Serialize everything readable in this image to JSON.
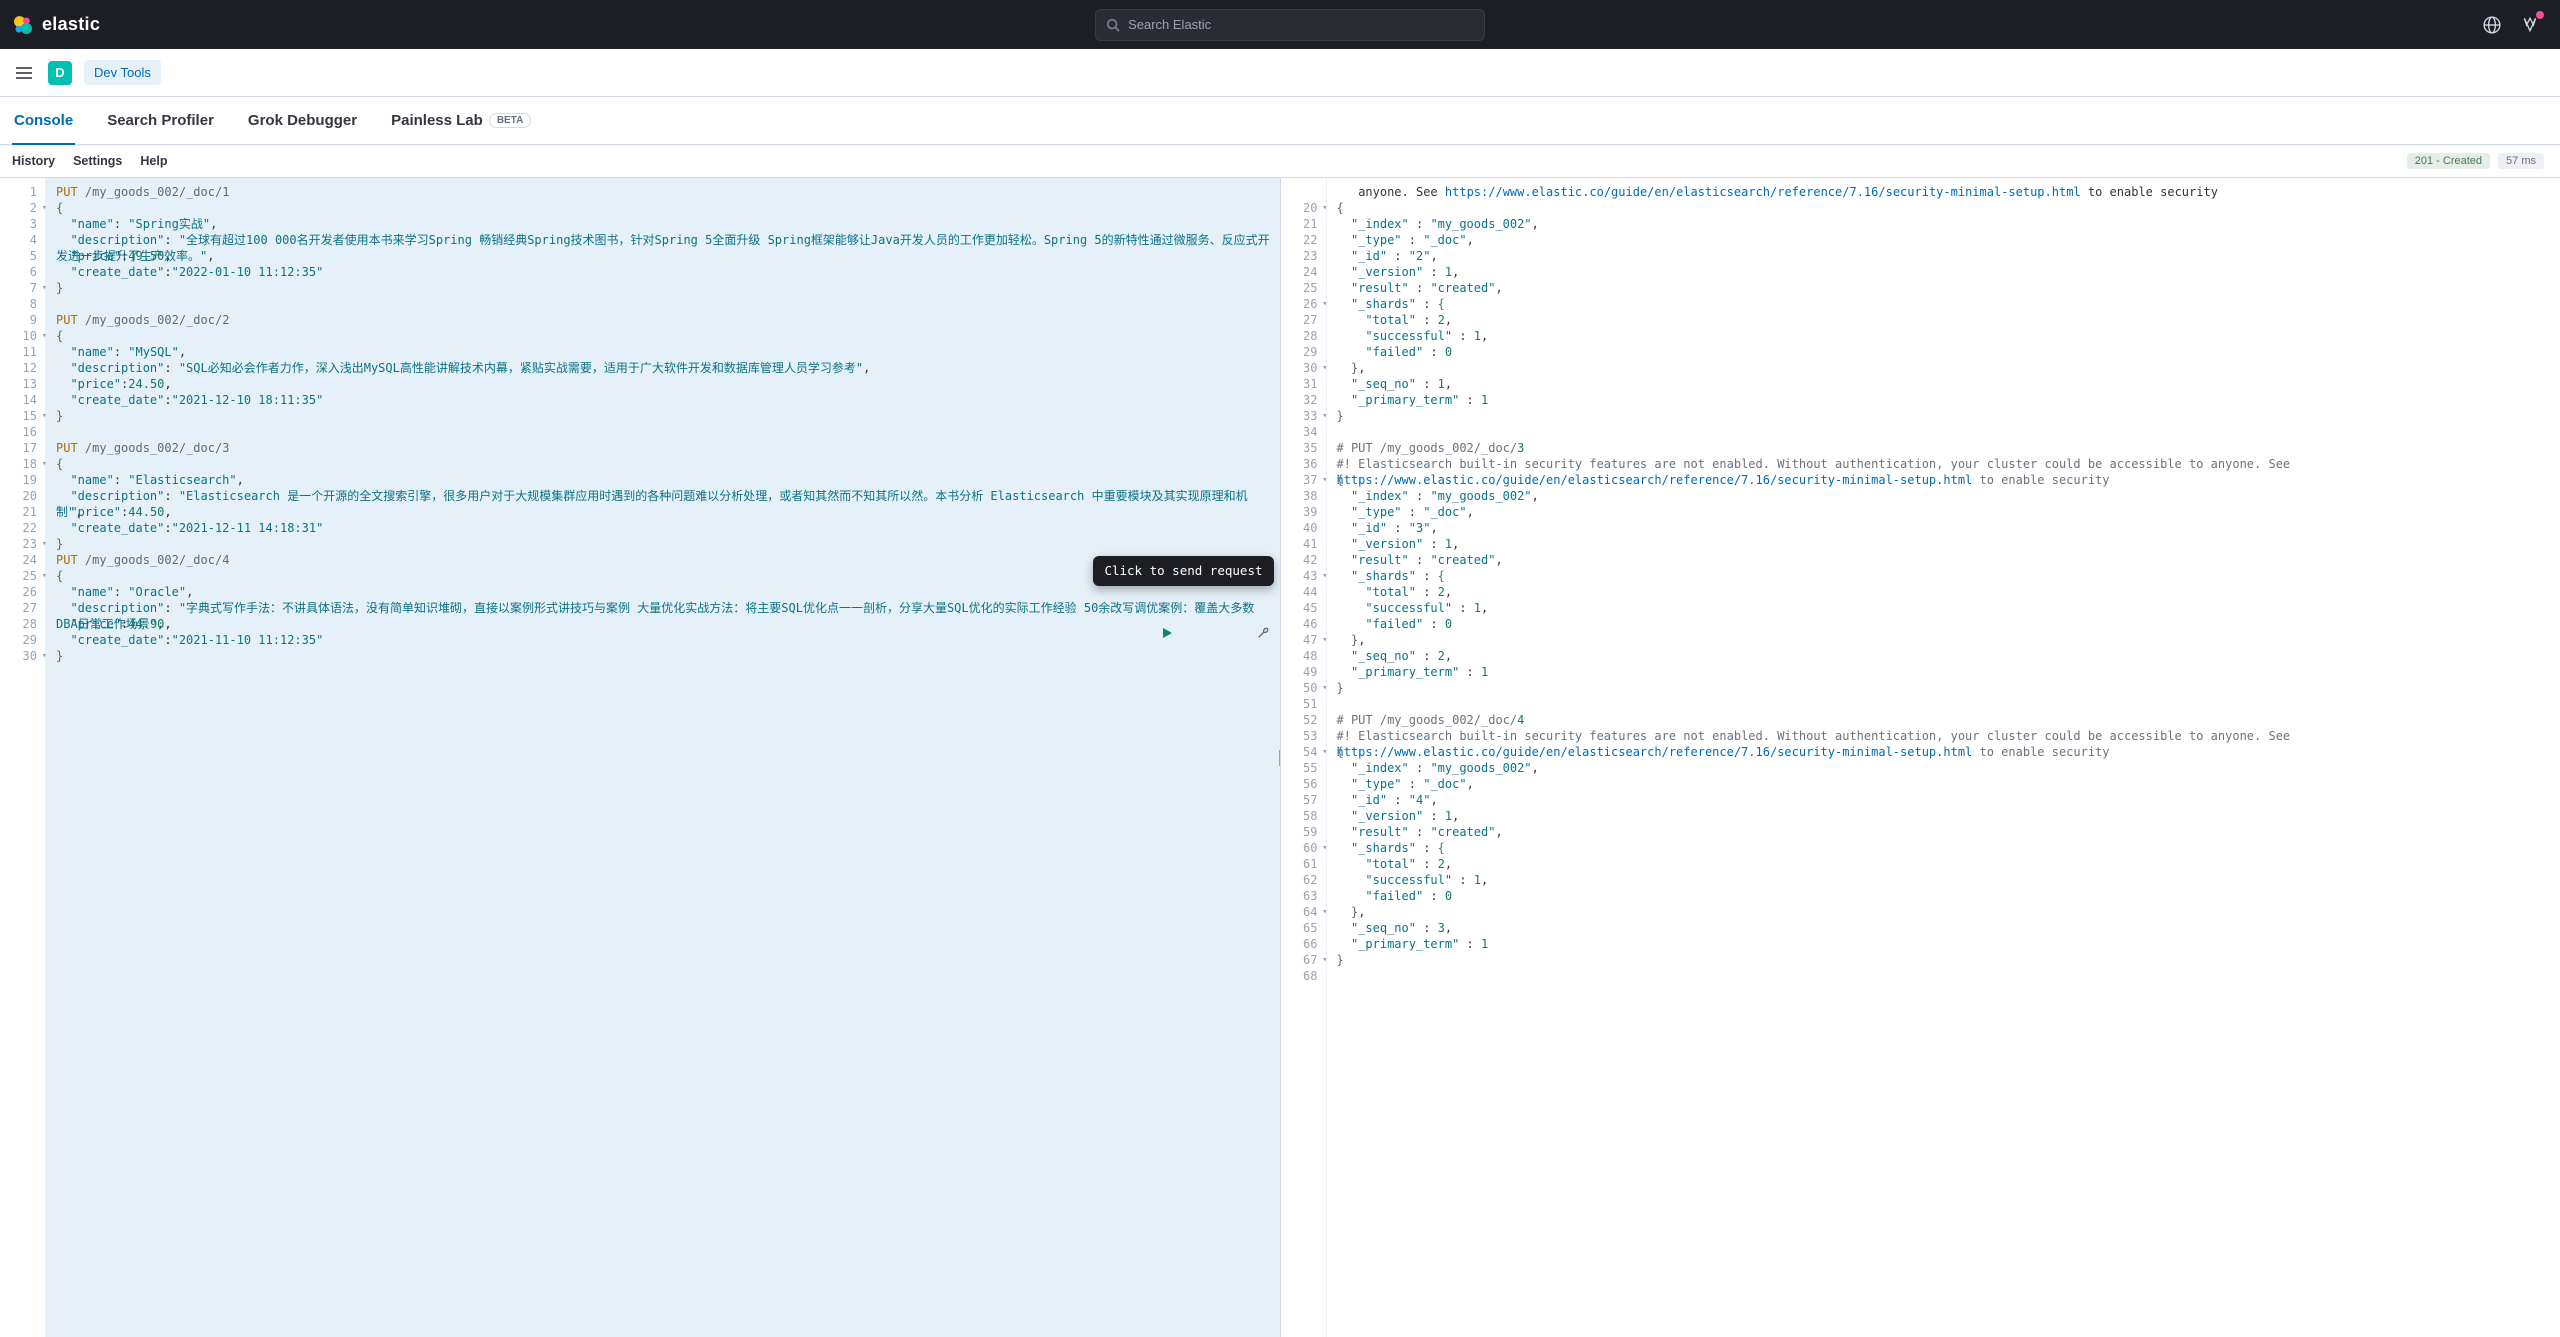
{
  "header": {
    "brand": "elastic",
    "search_placeholder": "Search Elastic"
  },
  "subheader": {
    "space_initial": "D",
    "breadcrumb": "Dev Tools"
  },
  "tabs": {
    "console": "Console",
    "search_profiler": "Search Profiler",
    "grok_debugger": "Grok Debugger",
    "painless_lab": "Painless Lab",
    "beta": "BETA"
  },
  "tools": {
    "history": "History",
    "settings": "Settings",
    "help": "Help"
  },
  "status": {
    "code": "201 - Created",
    "timing": "57 ms"
  },
  "tooltip": "Click to send request",
  "request": {
    "lines": [
      {
        "n": "1",
        "t": "<span class='mth'>PUT</span> <span class='pth'>/my_goods_002/_doc/1</span>"
      },
      {
        "n": "2",
        "fold": true,
        "t": "<span class='punc'>{</span>"
      },
      {
        "n": "3",
        "t": "  <span class='key'>\"name\"</span>: <span class='str'>\"Spring实战\"</span>,"
      },
      {
        "n": "4",
        "t": "  <span class='key'>\"description\"</span>: <span class='str'>\"全球有超过100 000名开发者使用本书来学习Spring 畅销经典Spring技术图书，针对Spring 5全面升级 Spring框架能够让Java开发人员的工作更加轻松。Spring 5的新特性通过微服务、反应式开发进一步提升了生产效率。\"</span>,"
      },
      {
        "n": "5",
        "t": "  <span class='key'>\"price\"</span>:<span class='num'>49.50</span>,"
      },
      {
        "n": "6",
        "t": "  <span class='key'>\"create_date\"</span>:<span class='str'>\"2022-01-10 11:12:35\"</span>"
      },
      {
        "n": "7",
        "fold": true,
        "t": "<span class='punc'>}</span>"
      },
      {
        "n": "8",
        "t": ""
      },
      {
        "n": "9",
        "t": "<span class='mth'>PUT</span> <span class='pth'>/my_goods_002/_doc/2</span>"
      },
      {
        "n": "10",
        "fold": true,
        "t": "<span class='punc'>{</span>"
      },
      {
        "n": "11",
        "t": "  <span class='key'>\"name\"</span>: <span class='str'>\"MySQL\"</span>,"
      },
      {
        "n": "12",
        "t": "  <span class='key'>\"description\"</span>: <span class='str'>\"SQL必知必会作者力作，深入浅出MySQL高性能讲解技术内幕，紧贴实战需要，适用于广大软件开发和数据库管理人员学习参考\"</span>,"
      },
      {
        "n": "13",
        "t": "  <span class='key'>\"price\"</span>:<span class='num'>24.50</span>,"
      },
      {
        "n": "14",
        "t": "  <span class='key'>\"create_date\"</span>:<span class='str'>\"2021-12-10 18:11:35\"</span>"
      },
      {
        "n": "15",
        "fold": true,
        "t": "<span class='punc'>}</span>"
      },
      {
        "n": "16",
        "t": ""
      },
      {
        "n": "17",
        "t": "<span class='mth'>PUT</span> <span class='pth'>/my_goods_002/_doc/3</span>"
      },
      {
        "n": "18",
        "fold": true,
        "t": "<span class='punc'>{</span>"
      },
      {
        "n": "19",
        "t": "  <span class='key'>\"name\"</span>: <span class='str'>\"Elasticsearch\"</span>,"
      },
      {
        "n": "20",
        "t": "  <span class='key'>\"description\"</span>: <span class='str'>\"Elasticsearch 是一个开源的全文搜索引擎，很多用户对于大规模集群应用时遇到的各种问题难以分析处理，或者知其然而不知其所以然。本书分析 Elasticsearch 中重要模块及其实现原理和机制\"</span>,"
      },
      {
        "n": "21",
        "t": "  <span class='key'>\"price\"</span>:<span class='num'>44.50</span>,"
      },
      {
        "n": "22",
        "t": "  <span class='key'>\"create_date\"</span>:<span class='str'>\"2021-12-11 14:18:31\"</span>"
      },
      {
        "n": "23",
        "fold": true,
        "t": "<span class='punc'>}</span>"
      },
      {
        "n": "24",
        "t": "<span class='mth'>PUT</span> <span class='pth'>/my_goods_002/_doc/4</span>"
      },
      {
        "n": "25",
        "fold": true,
        "t": "<span class='punc'>{</span>"
      },
      {
        "n": "26",
        "t": "  <span class='key'>\"name\"</span>: <span class='str'>\"Oracle\"</span>,"
      },
      {
        "n": "27",
        "t": "  <span class='key'>\"description\"</span>: <span class='str'>\"字典式写作手法：不讲具体语法，没有简单知识堆砌，直接以案例形式讲技巧与案例 大量优化实战方法：将主要SQL优化点一一剖析，分享大量SQL优化的实际工作经验 50余改写调优案例：覆盖大多数DBA日常工作场景\"</span>,"
      },
      {
        "n": "28",
        "t": "  <span class='key'>\"price\"</span>:<span class='num'>44.90</span>,"
      },
      {
        "n": "29",
        "t": "  <span class='key'>\"create_date\"</span>:<span class='str'>\"2021-11-10 11:12:35\"</span>"
      },
      {
        "n": "30",
        "fold": true,
        "t": "<span class='punc'>}</span>"
      }
    ]
  },
  "response": {
    "lines": [
      {
        "n": "",
        "t": "   anyone. See <span class='url'>https://www.elastic.co/guide/en/elasticsearch/reference/7.16/security-minimal-setup.html</span> to enable security"
      },
      {
        "n": "20",
        "fold": true,
        "t": "<span class='punc'>{</span>"
      },
      {
        "n": "21",
        "t": "  <span class='key'>\"_index\"</span> : <span class='str'>\"my_goods_002\"</span>,"
      },
      {
        "n": "22",
        "t": "  <span class='key'>\"_type\"</span> : <span class='str'>\"_doc\"</span>,"
      },
      {
        "n": "23",
        "t": "  <span class='key'>\"_id\"</span> : <span class='str'>\"2\"</span>,"
      },
      {
        "n": "24",
        "t": "  <span class='key'>\"_version\"</span> : <span class='num'>1</span>,"
      },
      {
        "n": "25",
        "t": "  <span class='key'>\"result\"</span> : <span class='str'>\"created\"</span>,"
      },
      {
        "n": "26",
        "fold": true,
        "t": "  <span class='key'>\"_shards\"</span> : <span class='punc'>{</span>"
      },
      {
        "n": "27",
        "t": "    <span class='key'>\"total\"</span> : <span class='num'>2</span>,"
      },
      {
        "n": "28",
        "t": "    <span class='key'>\"successful\"</span> : <span class='num'>1</span>,"
      },
      {
        "n": "29",
        "t": "    <span class='key'>\"failed\"</span> : <span class='num'>0</span>"
      },
      {
        "n": "30",
        "fold": true,
        "t": "  <span class='punc'>}</span>,"
      },
      {
        "n": "31",
        "t": "  <span class='key'>\"_seq_no\"</span> : <span class='num'>1</span>,"
      },
      {
        "n": "32",
        "t": "  <span class='key'>\"_primary_term\"</span> : <span class='num'>1</span>"
      },
      {
        "n": "33",
        "fold": true,
        "t": "<span class='punc'>}</span>"
      },
      {
        "n": "34",
        "t": ""
      },
      {
        "n": "35",
        "t": "<span class='cmt'># PUT /my_goods_002/_doc/</span><span class='num'>3</span>"
      },
      {
        "n": "36",
        "t": "<span class='warn'>#! Elasticsearch built-in security features are not enabled. Without authentication, your cluster could be accessible to anyone. See </span><span class='url'>https://www.elastic.co/guide/en/elasticsearch/reference/7.16/security-minimal-setup.html</span><span class='warn'> to enable security</span>"
      },
      {
        "n": "37",
        "fold": true,
        "t": "<span class='punc'>{</span>"
      },
      {
        "n": "38",
        "t": "  <span class='key'>\"_index\"</span> : <span class='str'>\"my_goods_002\"</span>,"
      },
      {
        "n": "39",
        "t": "  <span class='key'>\"_type\"</span> : <span class='str'>\"_doc\"</span>,"
      },
      {
        "n": "40",
        "t": "  <span class='key'>\"_id\"</span> : <span class='str'>\"3\"</span>,"
      },
      {
        "n": "41",
        "t": "  <span class='key'>\"_version\"</span> : <span class='num'>1</span>,"
      },
      {
        "n": "42",
        "t": "  <span class='key'>\"result\"</span> : <span class='str'>\"created\"</span>,"
      },
      {
        "n": "43",
        "fold": true,
        "t": "  <span class='key'>\"_shards\"</span> : <span class='punc'>{</span>"
      },
      {
        "n": "44",
        "t": "    <span class='key'>\"total\"</span> : <span class='num'>2</span>,"
      },
      {
        "n": "45",
        "t": "    <span class='key'>\"successful\"</span> : <span class='num'>1</span>,"
      },
      {
        "n": "46",
        "t": "    <span class='key'>\"failed\"</span> : <span class='num'>0</span>"
      },
      {
        "n": "47",
        "fold": true,
        "t": "  <span class='punc'>}</span>,"
      },
      {
        "n": "48",
        "t": "  <span class='key'>\"_seq_no\"</span> : <span class='num'>2</span>,"
      },
      {
        "n": "49",
        "t": "  <span class='key'>\"_primary_term\"</span> : <span class='num'>1</span>"
      },
      {
        "n": "50",
        "fold": true,
        "t": "<span class='punc'>}</span>"
      },
      {
        "n": "51",
        "t": ""
      },
      {
        "n": "52",
        "t": "<span class='cmt'># PUT /my_goods_002/_doc/</span><span class='num'>4</span>"
      },
      {
        "n": "53",
        "t": "<span class='warn'>#! Elasticsearch built-in security features are not enabled. Without authentication, your cluster could be accessible to anyone. See </span><span class='url'>https://www.elastic.co/guide/en/elasticsearch/reference/7.16/security-minimal-setup.html</span><span class='warn'> to enable security</span>"
      },
      {
        "n": "54",
        "fold": true,
        "t": "<span class='punc'>{</span>"
      },
      {
        "n": "55",
        "t": "  <span class='key'>\"_index\"</span> : <span class='str'>\"my_goods_002\"</span>,"
      },
      {
        "n": "56",
        "t": "  <span class='key'>\"_type\"</span> : <span class='str'>\"_doc\"</span>,"
      },
      {
        "n": "57",
        "t": "  <span class='key'>\"_id\"</span> : <span class='str'>\"4\"</span>,"
      },
      {
        "n": "58",
        "t": "  <span class='key'>\"_version\"</span> : <span class='num'>1</span>,"
      },
      {
        "n": "59",
        "t": "  <span class='key'>\"result\"</span> : <span class='str'>\"created\"</span>,"
      },
      {
        "n": "60",
        "fold": true,
        "t": "  <span class='key'>\"_shards\"</span> : <span class='punc'>{</span>"
      },
      {
        "n": "61",
        "t": "    <span class='key'>\"total\"</span> : <span class='num'>2</span>,"
      },
      {
        "n": "62",
        "t": "    <span class='key'>\"successful\"</span> : <span class='num'>1</span>,"
      },
      {
        "n": "63",
        "t": "    <span class='key'>\"failed\"</span> : <span class='num'>0</span>"
      },
      {
        "n": "64",
        "fold": true,
        "t": "  <span class='punc'>}</span>,"
      },
      {
        "n": "65",
        "t": "  <span class='key'>\"_seq_no\"</span> : <span class='num'>3</span>,"
      },
      {
        "n": "66",
        "t": "  <span class='key'>\"_primary_term\"</span> : <span class='num'>1</span>"
      },
      {
        "n": "67",
        "fold": true,
        "t": "<span class='punc'>}</span>"
      },
      {
        "n": "68",
        "t": ""
      }
    ]
  }
}
